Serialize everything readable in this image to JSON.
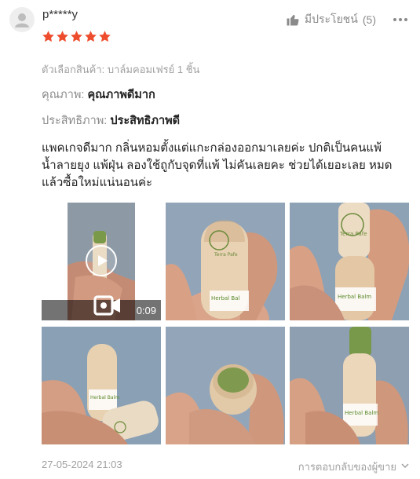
{
  "review": {
    "username": "p*****y",
    "rating": 5,
    "helpful_label": "มีประโยชน์",
    "helpful_count": "(5)",
    "variation": "ตัวเลือกสินค้า: บาล์มคอมเฟรย์ 1 ชิ้น",
    "attributes": [
      {
        "label": "คุณภาพ:",
        "value": "คุณภาพดีมาก"
      },
      {
        "label": "ประสิทธิภาพ:",
        "value": "ประสิทธิภาพดี"
      }
    ],
    "text": "แพคเกจดีมาก กลิ่นหอมตั้งแต่แกะกล่องออกมาเลยค่ะ ปกติเป็นคนแพ้น้ำลายยุง แพ้ฝุ่น ลองใช้ถูกับจุดที่แพ้ ไม่คันเลยคะ ช่วยได้เยอะเลย หมดแล้วซื้อใหม่แน่นอนค่ะ",
    "video_duration": "0:09",
    "product_label_brand": "Terra Pafe",
    "product_label_name": "Herbal Balm",
    "date": "27-05-2024 21:03",
    "seller_reply_label": "การตอบกลับของผู้ขาย"
  },
  "colors": {
    "star": "#ee4d2d",
    "muted": "#8a8a8a",
    "balm_green": "#7a9a4a",
    "tube_beige": "#e9d2b4"
  },
  "icons": {
    "avatar": "user-avatar-icon",
    "helpful": "thumbs-up-icon",
    "more": "more-horizontal-icon",
    "play": "play-icon",
    "video": "video-camera-icon",
    "chevron": "chevron-down-icon"
  }
}
